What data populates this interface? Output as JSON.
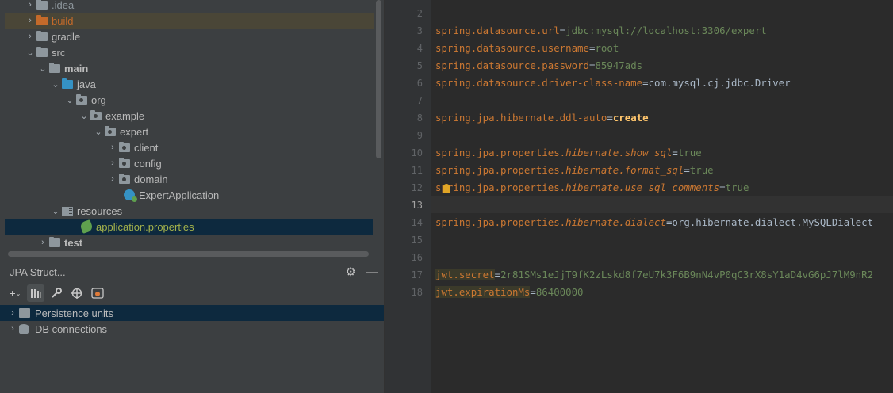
{
  "project_tree": {
    "items": [
      {
        "label": ".idea",
        "arrow": "›",
        "icon": "folder",
        "color": "#8e979d"
      },
      {
        "label": "build",
        "arrow": "›",
        "icon": "folder-orange",
        "color": "#c46a2a"
      },
      {
        "label": "gradle",
        "arrow": "›",
        "icon": "folder"
      },
      {
        "label": "src",
        "arrow": "⌄",
        "icon": "folder"
      },
      {
        "label": "main",
        "arrow": "⌄",
        "icon": "module-folder"
      },
      {
        "label": "java",
        "arrow": "⌄",
        "icon": "folder-blue"
      },
      {
        "label": "org",
        "arrow": "⌄",
        "icon": "package"
      },
      {
        "label": "example",
        "arrow": "⌄",
        "icon": "package"
      },
      {
        "label": "expert",
        "arrow": "⌄",
        "icon": "package"
      },
      {
        "label": "client",
        "arrow": "›",
        "icon": "package"
      },
      {
        "label": "config",
        "arrow": "›",
        "icon": "package"
      },
      {
        "label": "domain",
        "arrow": "›",
        "icon": "package"
      },
      {
        "label": "ExpertApplication",
        "icon": "spring-class"
      },
      {
        "label": "resources",
        "arrow": "⌄",
        "icon": "resources-folder"
      },
      {
        "label": "application.properties",
        "icon": "properties-file",
        "color": "#a4b24b"
      },
      {
        "label": "test",
        "arrow": "›",
        "icon": "module-folder"
      }
    ]
  },
  "jpa_panel": {
    "title": "JPA Struct...",
    "settings_icon": "gear-icon",
    "minimize_icon": "minimize-icon",
    "toolbar": [
      "add-icon",
      "bars-icon",
      "wrench-icon",
      "target-icon",
      "eye-icon"
    ],
    "items": [
      {
        "label": "Persistence units",
        "arrow": "›",
        "icon": "persistence-icon"
      },
      {
        "label": "DB connections",
        "arrow": "›",
        "icon": "database-icon"
      }
    ]
  },
  "editor": {
    "line_numbers": [
      "2",
      "3",
      "4",
      "5",
      "6",
      "7",
      "8",
      "9",
      "10",
      "11",
      "12",
      "13",
      "14",
      "15",
      "16",
      "17",
      "18"
    ],
    "lines": {
      "l3": {
        "key": "spring.datasource.url",
        "eq": "=",
        "value": "jdbc:mysql://localhost:3306/expert"
      },
      "l4": {
        "key": "spring.datasource.username",
        "eq": "=",
        "value": "root"
      },
      "l5": {
        "key": "spring.datasource.password",
        "eq": "=",
        "value": "85947ads"
      },
      "l6": {
        "key": "spring.datasource.driver-class-name",
        "eq": "=",
        "value": "com.mysql.cj.jdbc.Driver"
      },
      "l8": {
        "key": "spring.jpa.hibernate.ddl-auto",
        "eq": "=",
        "value": "create"
      },
      "l10": {
        "key_a": "spring.jpa.properties.",
        "key_b": "hibernate.show_sql",
        "eq": "=",
        "value": "true"
      },
      "l11": {
        "key_a": "spring.jpa.properties.",
        "key_b": "hibernate.format_sql",
        "eq": "=",
        "value": "true"
      },
      "l12": {
        "key_a": "spring.jpa.properties.",
        "key_b": "hibernate.use_sql_comments",
        "eq": "=",
        "value": "true"
      },
      "l14": {
        "key_a": "spring.jpa.properties.",
        "key_b": "hibernate.dialect",
        "eq": "=",
        "value": "org.hibernate.dialect.MySQLDialect"
      },
      "l17": {
        "key": "jwt.secret",
        "eq": "=",
        "value": "2r81SMs1eJjT9fK2zLskd8f7eU7k3F6B9nN4vP0qC3rX8sY1aD4vG6pJ7lM9nR2"
      },
      "l18": {
        "key": "jwt.expirationMs",
        "eq": "=",
        "value": "86400000"
      }
    }
  }
}
